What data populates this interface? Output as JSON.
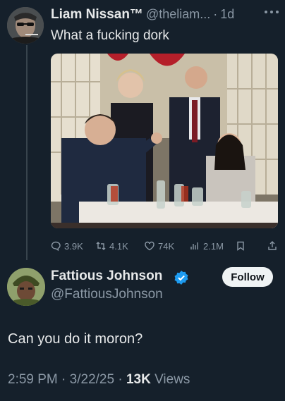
{
  "quoted_tweet": {
    "display_name": "Liam Nissan™",
    "handle": "@theliam...",
    "separator": "·",
    "time": "1d",
    "text": "What a fucking dork"
  },
  "stats": {
    "replies": "3.9K",
    "retweets": "4.1K",
    "likes": "74K",
    "views": "2.1M"
  },
  "reply_tweet": {
    "display_name": "Fattious Johnson",
    "handle": "@FattiousJohnson",
    "follow_label": "Follow",
    "text": "Can you do it moron?",
    "time": "2:59 PM",
    "date": "3/22/25",
    "views_count": "13K",
    "views_label": "Views"
  },
  "colors": {
    "background": "#15202b",
    "verified": "#1d9bf0",
    "muted": "#8b98a5"
  }
}
